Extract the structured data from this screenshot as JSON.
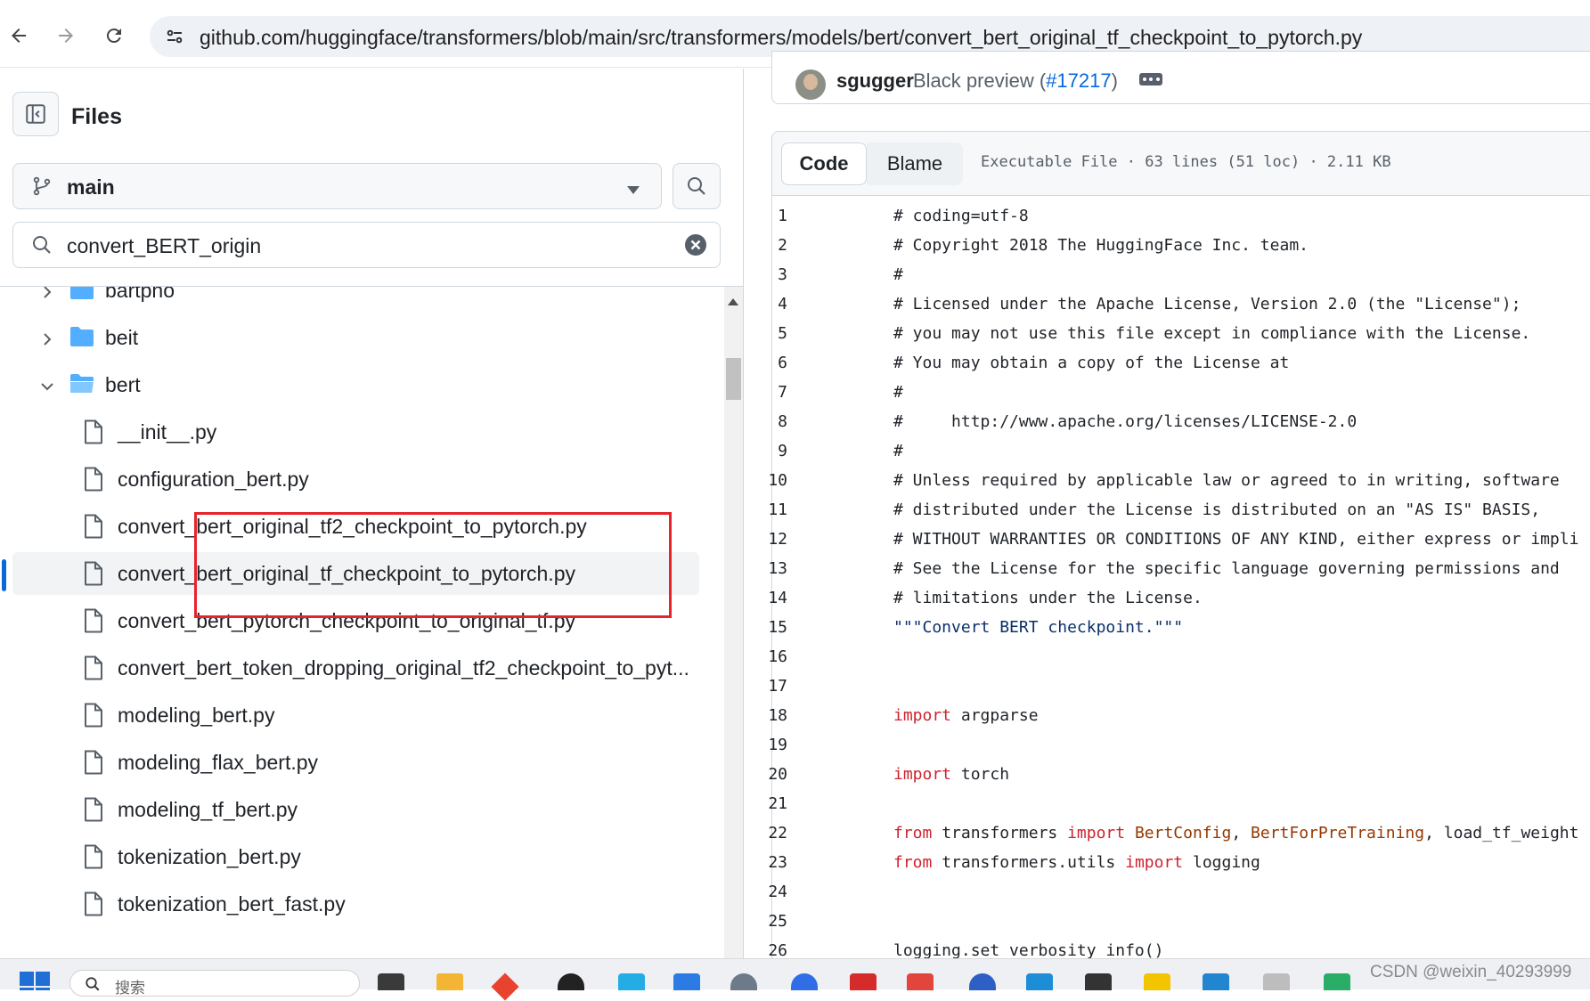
{
  "browser": {
    "url": "github.com/huggingface/transformers/blob/main/src/transformers/models/bert/convert_bert_original_tf_checkpoint_to_pytorch.py"
  },
  "sidebar": {
    "title": "Files",
    "branch": "main",
    "search_value": "convert_BERT_origin",
    "tree": [
      {
        "type": "folder",
        "name": "bartpho",
        "expanded": false
      },
      {
        "type": "folder",
        "name": "beit",
        "expanded": false
      },
      {
        "type": "folder",
        "name": "bert",
        "expanded": true
      },
      {
        "type": "file",
        "name": "__init__.py"
      },
      {
        "type": "file",
        "name": "configuration_bert.py"
      },
      {
        "type": "file",
        "name": "convert_bert_original_tf2_checkpoint_to_pytorch.py"
      },
      {
        "type": "file",
        "name": "convert_bert_original_tf_checkpoint_to_pytorch.py",
        "selected": true
      },
      {
        "type": "file",
        "name": "convert_bert_pytorch_checkpoint_to_original_tf.py"
      },
      {
        "type": "file",
        "name": "convert_bert_token_dropping_original_tf2_checkpoint_to_pyt..."
      },
      {
        "type": "file",
        "name": "modeling_bert.py"
      },
      {
        "type": "file",
        "name": "modeling_flax_bert.py"
      },
      {
        "type": "file",
        "name": "modeling_tf_bert.py"
      },
      {
        "type": "file",
        "name": "tokenization_bert.py"
      },
      {
        "type": "file",
        "name": "tokenization_bert_fast.py"
      }
    ]
  },
  "commit": {
    "author": "sgugger",
    "message": "Black preview (",
    "pr": "#17217",
    "message_end": ")"
  },
  "file_header": {
    "tabs": [
      "Code",
      "Blame"
    ],
    "active_tab": "Code",
    "info": "Executable File · 63 lines (51 loc) · 2.11 KB"
  },
  "code": [
    {
      "n": "1",
      "parts": [
        {
          "t": "# coding=utf-8",
          "c": "comment"
        }
      ]
    },
    {
      "n": "2",
      "parts": [
        {
          "t": "# Copyright 2018 The HuggingFace Inc. team.",
          "c": "comment"
        }
      ]
    },
    {
      "n": "3",
      "parts": [
        {
          "t": "#",
          "c": "comment"
        }
      ]
    },
    {
      "n": "4",
      "parts": [
        {
          "t": "# Licensed under the Apache License, Version 2.0 (the \"License\");",
          "c": "comment"
        }
      ]
    },
    {
      "n": "5",
      "parts": [
        {
          "t": "# you may not use this file except in compliance with the License.",
          "c": "comment"
        }
      ]
    },
    {
      "n": "6",
      "parts": [
        {
          "t": "# You may obtain a copy of the License at",
          "c": "comment"
        }
      ]
    },
    {
      "n": "7",
      "parts": [
        {
          "t": "#",
          "c": "comment"
        }
      ]
    },
    {
      "n": "8",
      "parts": [
        {
          "t": "#     http://www.apache.org/licenses/LICENSE-2.0",
          "c": "comment"
        }
      ]
    },
    {
      "n": "9",
      "parts": [
        {
          "t": "#",
          "c": "comment"
        }
      ]
    },
    {
      "n": "10",
      "parts": [
        {
          "t": "# Unless required by applicable law or agreed to in writing, software",
          "c": "comment"
        }
      ]
    },
    {
      "n": "11",
      "parts": [
        {
          "t": "# distributed under the License is distributed on an \"AS IS\" BASIS,",
          "c": "comment"
        }
      ]
    },
    {
      "n": "12",
      "parts": [
        {
          "t": "# WITHOUT WARRANTIES OR CONDITIONS OF ANY KIND, either express or impli",
          "c": "comment"
        }
      ]
    },
    {
      "n": "13",
      "parts": [
        {
          "t": "# See the License for the specific language governing permissions and",
          "c": "comment"
        }
      ]
    },
    {
      "n": "14",
      "parts": [
        {
          "t": "# limitations under the License.",
          "c": "comment"
        }
      ]
    },
    {
      "n": "15",
      "parts": [
        {
          "t": "\"\"\"Convert BERT checkpoint.\"\"\"",
          "c": "str"
        }
      ]
    },
    {
      "n": "16",
      "parts": []
    },
    {
      "n": "17",
      "parts": []
    },
    {
      "n": "18",
      "parts": [
        {
          "t": "import",
          "c": "kw"
        },
        {
          "t": " argparse",
          "c": ""
        }
      ]
    },
    {
      "n": "19",
      "parts": []
    },
    {
      "n": "20",
      "parts": [
        {
          "t": "import",
          "c": "kw"
        },
        {
          "t": " torch",
          "c": ""
        }
      ]
    },
    {
      "n": "21",
      "parts": []
    },
    {
      "n": "22",
      "parts": [
        {
          "t": "from",
          "c": "kw"
        },
        {
          "t": " transformers ",
          "c": ""
        },
        {
          "t": "import",
          "c": "kw"
        },
        {
          "t": " ",
          "c": ""
        },
        {
          "t": "BertConfig",
          "c": "cls"
        },
        {
          "t": ", ",
          "c": ""
        },
        {
          "t": "BertForPreTraining",
          "c": "cls"
        },
        {
          "t": ", load_tf_weight",
          "c": ""
        }
      ]
    },
    {
      "n": "23",
      "parts": [
        {
          "t": "from",
          "c": "kw"
        },
        {
          "t": " transformers.utils ",
          "c": ""
        },
        {
          "t": "import",
          "c": "kw"
        },
        {
          "t": " logging",
          "c": ""
        }
      ]
    },
    {
      "n": "24",
      "parts": []
    },
    {
      "n": "25",
      "parts": []
    },
    {
      "n": "26",
      "parts": [
        {
          "t": "logging.set_verbosity_info()",
          "c": ""
        }
      ]
    }
  ],
  "taskbar": {
    "search_placeholder": "搜索",
    "watermark": "CSDN @weixin_40293999"
  },
  "colors": {
    "accent_blue": "#0969da",
    "folder_blue": "#54aeff",
    "highlight_red": "#e5242b",
    "keyword_red": "#cf222e",
    "string_navy": "#0a3069",
    "class_orange": "#953800"
  }
}
